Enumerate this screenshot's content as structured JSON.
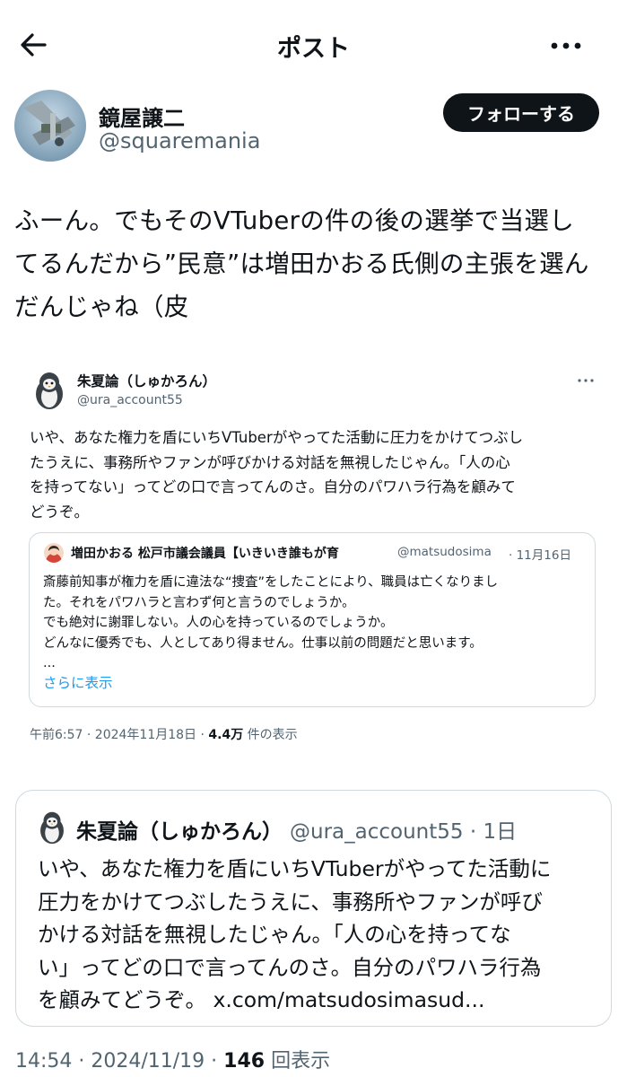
{
  "header": {
    "title": "ポスト",
    "back_icon": "arrow-left-icon",
    "more_icon": "more-dots-icon"
  },
  "author": {
    "name": "鏡屋譲二",
    "handle": "@squaremania",
    "follow_label": "フォローする"
  },
  "post": {
    "lines": [
      "ふーん。でもそのVTuberの件の後の選挙で当選し",
      "てるんだから”民意”は増田かおる氏側の主張を選ん",
      "だんじゃね（皮"
    ]
  },
  "screenshot": {
    "name": "朱夏論（しゅかろん）",
    "handle": "@ura_account55",
    "lines": [
      "いや、あなた権力を盾にいちVTuberがやってた活動に圧力をかけてつぶし",
      "たうえに、事務所やファンが呼びかける対話を無視したじゃん。「人の心",
      "を持ってない」ってどの口で言ってんのさ。自分のパワハラ行為を顧みて",
      "どうぞ。"
    ],
    "inner": {
      "name": "増田かおる 松戸市議会議員【いきいき誰もが育",
      "handle": "@matsudosima",
      "date": "· 11月16日",
      "lines": [
        "斎藤前知事が権力を盾に違法な“捜査”をしたことにより、職員は亡くなりまし",
        "た。それをパワハラと言わず何と言うのでしょうか。",
        "でも絶対に謝罪しない。人の心を持っているのでしょうか。",
        "どんなに優秀でも、人としてあり得ません。仕事以前の問題だと思います。"
      ],
      "ellipsis": "...",
      "show_more": "さらに表示"
    },
    "meta_time": "午前6:57 · 2024年11月18日 · ",
    "meta_views_count": "4.4万",
    "meta_views_label": " 件の表示"
  },
  "quote": {
    "name": "朱夏論（しゅかろん）",
    "handle": "@ura_account55 · 1日",
    "lines": [
      "いや、あなた権力を盾にいちVTuberがやってた活動に",
      "圧力をかけてつぶしたうえに、事務所やファンが呼び",
      "かける対話を無視したじゃん。「人の心を持ってな",
      "い」ってどの口で言ってんのさ。自分のパワハラ行為",
      "を顧みてどうぞ。 "
    ],
    "link": "x.com/matsudosimasud..."
  },
  "meta": {
    "time": "14:54 · 2024/11/19 · ",
    "views_count": "146",
    "views_label": " 回表示"
  }
}
